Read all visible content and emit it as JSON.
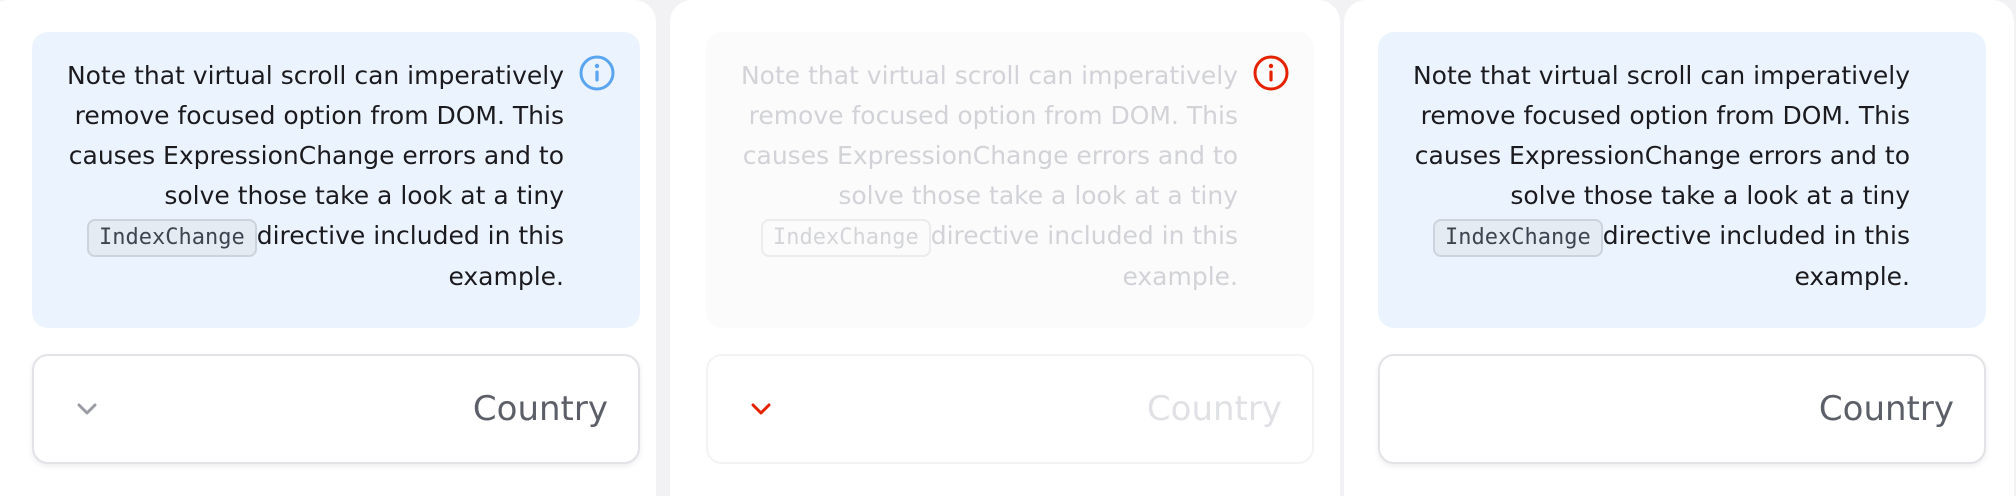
{
  "notice": {
    "lines": [
      "Note that virtual scroll can imperatively",
      "remove focused option from DOM. This",
      "causes ExpressionChange errors and to",
      "solve those take a look at a tiny"
    ],
    "code": "IndexChange",
    "line5_text": "directive included in this",
    "line6": ".example"
  },
  "select": {
    "label": "Country"
  },
  "colors": {
    "info_blue": "#5aa5f0",
    "error_red": "#e52200",
    "notice_bg": "#ebf4fe"
  },
  "icons": {
    "info": "info-icon",
    "error": "alert-icon",
    "chevron": "chevron-down-icon"
  }
}
